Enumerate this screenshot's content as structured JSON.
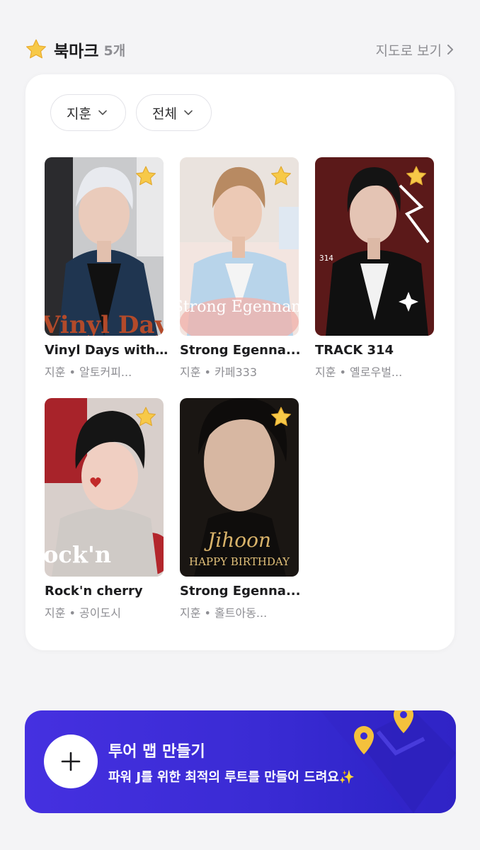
{
  "header": {
    "icon": "star-icon",
    "title": "북마크",
    "count": "5개",
    "map_link": "지도로 보기"
  },
  "filters": [
    {
      "label": "지훈"
    },
    {
      "label": "전체"
    }
  ],
  "bookmarks": [
    {
      "title": "Vinyl Days with ...",
      "subtitle": "지훈 • 알토커피...",
      "poster_text": "Vinyl Day"
    },
    {
      "title": "Strong Egenna...",
      "subtitle": "지훈 • 카페333",
      "poster_text": "Strong Egennam"
    },
    {
      "title": "TRACK 314",
      "subtitle": "지훈 • 옐로우벌...",
      "poster_text": "314"
    },
    {
      "title": "Rock'n cherry",
      "subtitle": "지훈 • 공이도시",
      "poster_text": "ock'n"
    },
    {
      "title": "Strong Egenna...",
      "subtitle": "지훈 • 홀트아동...",
      "poster_text": "Jihoon HAPPY BIRTHDAY"
    }
  ],
  "banner": {
    "title": "투어 맵 만들기",
    "subtitle": "파워 J를 위한 최적의 루트를 만들어 드려요✨"
  },
  "colors": {
    "banner": "#3a2bd4",
    "star": "#f7c948",
    "muted": "#8e8e93"
  }
}
